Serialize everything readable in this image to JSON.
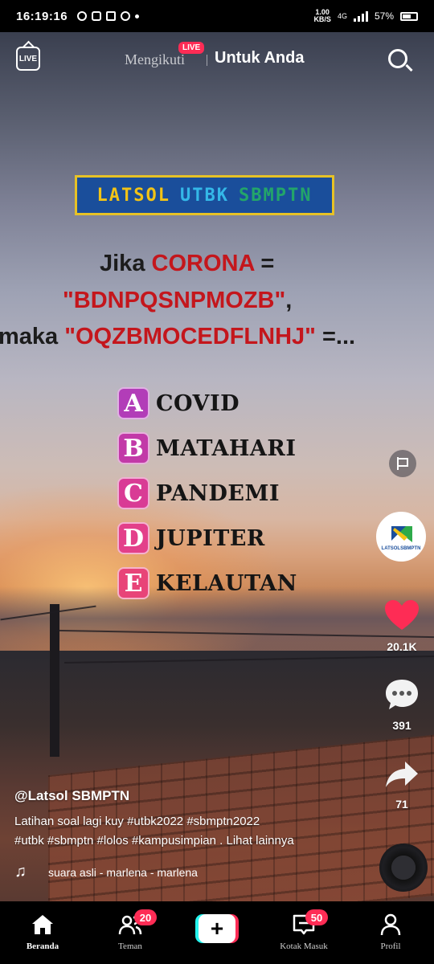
{
  "status_bar": {
    "time": "16:19:16",
    "net_speed": "1.00",
    "net_unit": "KB/S",
    "network": "4G",
    "battery": "57%"
  },
  "top_nav": {
    "live_icon_label": "LIVE",
    "tab_following": "Mengikuti",
    "live_badge": "LIVE",
    "tab_for_you": "Untuk Anda"
  },
  "video": {
    "banner_words": [
      "LATSOL",
      "UTBK",
      "SBMPTN"
    ],
    "question": {
      "line1_prefix": "Jika",
      "line1_keyword": "CORONA",
      "line1_suffix": "=",
      "line2_code": "\"BDNPQSNPMOZB\"",
      "line2_suffix": ",",
      "line3_prefix": "maka",
      "line3_code": "\"OQZBMOCEDFLNHJ\"",
      "line3_suffix": "=..."
    },
    "options": [
      {
        "letter": "A",
        "text": "COVID",
        "color": "#b23db8"
      },
      {
        "letter": "B",
        "text": "MATAHARI",
        "color": "#c23aa8"
      },
      {
        "letter": "C",
        "text": "PANDEMI",
        "color": "#d93b95"
      },
      {
        "letter": "D",
        "text": "JUPITER",
        "color": "#e3408a"
      },
      {
        "letter": "E",
        "text": "KELAUTAN",
        "color": "#e84478"
      }
    ]
  },
  "actions": {
    "avatar_label": "LATSOLSBMPTN",
    "likes": "20.1K",
    "comments": "391",
    "shares": "71"
  },
  "caption": {
    "author": "@Latsol SBMPTN",
    "line1": "Latihan soal lagi kuy #utbk2022 #sbmptn2022",
    "line2": "#utbk #sbmptn #lolos #kampusimpian .",
    "see_more": "Lihat lainnya",
    "music": "suara asli - marlena - marlena"
  },
  "bottom_nav": {
    "home": "Beranda",
    "friends": "Teman",
    "friends_badge": "20",
    "create": "+",
    "inbox": "Kotak Masuk",
    "inbox_badge": "50",
    "profile": "Profil"
  },
  "colors": {
    "accent": "#fe2c55",
    "secondary_accent": "#25f4ee",
    "question_red": "#c4161c",
    "banner_bg": "#1a4e9b"
  }
}
